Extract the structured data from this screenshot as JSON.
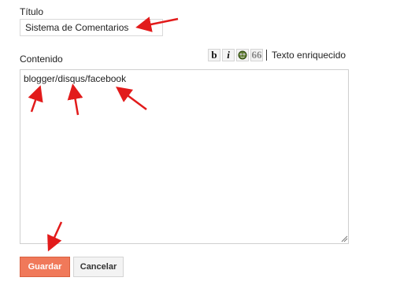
{
  "form": {
    "title_label": "Título",
    "title_value": "Sistema de Comentarios",
    "content_label": "Contenido",
    "content_value": "blogger/disqus/facebook",
    "rich_text_label": "Texto enriquecido",
    "save_label": "Guardar",
    "cancel_label": "Cancelar"
  },
  "toolbar": {
    "bold": "b",
    "italic": "i",
    "quote": "66"
  },
  "colors": {
    "accent": "#f0795a",
    "annotation_arrow": "#e21b1b"
  },
  "icons": [
    "bold-icon",
    "italic-icon",
    "emoji-icon",
    "quote-icon",
    "resize-grip-icon",
    "arrow-annotation"
  ]
}
